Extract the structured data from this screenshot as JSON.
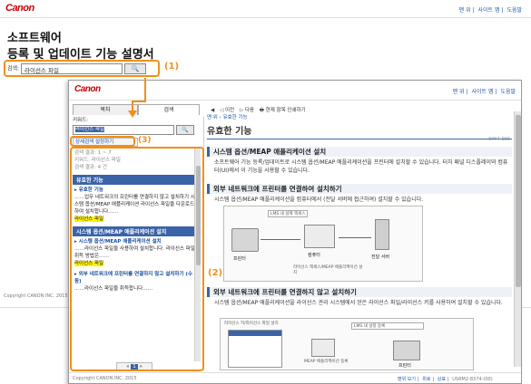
{
  "back": {
    "logo": "Canon",
    "toplinks": [
      "맨 위",
      "사이트 맵",
      "도움말"
    ],
    "title_line1": "소프트웨어",
    "title_line2": "등록 및 업데이트 기능 설명서",
    "search_label": "검색:",
    "search_value": "라이선스 파일",
    "copyright": "Copyright CANON INC. 2015"
  },
  "callouts": {
    "c1": "(1)",
    "c2": "(2)",
    "c3": "(3)"
  },
  "front": {
    "logo": "Canon",
    "toplinks": [
      "맨 위",
      "사이트 맵",
      "도움말"
    ],
    "tabs": [
      "목차",
      "검색"
    ],
    "toolbar": {
      "prev": "이전",
      "next": "다음",
      "print": "현재 항목 인쇄하기"
    },
    "keyword_label": "키워드:",
    "keyword_value": "라이선스 파일",
    "detail_search": "상세검색 설정하기",
    "summary_lines": [
      "검색 결과: 1 ~ 7",
      "키워드: 라이선스 파일",
      "검색 결과: 4 건"
    ],
    "results": [
      {
        "section": "유효한 기능",
        "title": "유효한 기능",
        "snippet": "……업무 네트워크의 프린터를 연결하지 않고 설치하기 시스템 옵션/MEAP 애플리케이션 라이선스 파일을 다운로드하여 설치합니다……"
      },
      {
        "section": "시스템 옵션/MEAP 애플리케이션 설치",
        "title": "시스템 옵션/MEAP 애플리케이션 설치",
        "snippet": "……라이선스 파일을 사용하여 설치합니다. 라이선스 파일 취득 방법은……"
      },
      {
        "section": "",
        "title": "외부 네트워크에 프린터를 연결하지 않고 설치하기 (수동)",
        "snippet": "……라이선스 파일을 취득합니다……"
      }
    ],
    "page_indicator": "1",
    "breadcrumb": "맨 위 › 유효한 기능",
    "page_title": "유효한 기능",
    "page_code": "0YY4-000",
    "sec1_heading": "시스템 옵션/MEAP 애플리케이션 설치",
    "sec1_text": "소프트웨어 기능 등록/업데이트로 시스템 옵션/MEAP 애플리케이션을 프린터에 설치할 수 있습니다. 터치 패널 디스플레이와 컴퓨터(UI)에서 이 기능을 사용할 수 있습니다.",
    "sec2_heading": "외부 네트워크에 프린터를 연결하여 설치하기",
    "sec2_text": "시스템 옵션/MEAP 애플리케이션을 컴퓨터에서 (전달 서버에 접근하여) 설치할 수 있습니다.",
    "diag1": {
      "printer": "프린터",
      "server": "전달 서버",
      "pc": "컴퓨터",
      "arrow_top": "LMS 내 실제 액세스",
      "arrow_bottom": "라이선스 액세스/MEAP 애플리케이션 설치"
    },
    "sec3_heading": "외부 네트워크에 프린터를 연결하지 않고 설치하기",
    "sec3_text": "시스템 옵션/MEAP 애플리케이션을 라이선스 관리 시스템에서 얻은 라이선스 파일/라이선스 키를 사용하여 설치할 수 있습니다.",
    "diag2": {
      "left_label": "라이선스 키/라이선스 파일 설치",
      "right_label": "LMS 내 설정 등록",
      "mid_label": "MEAP 애플리케이션 등록",
      "printer": "프린터",
      "pc": "컴퓨터"
    },
    "footer_links": [
      "맨위 보기",
      "위로",
      "상표"
    ],
    "footer_code": "USRM2-8374-(00)",
    "copyright": "Copyright CANON INC. 2015"
  },
  "colors": {
    "accent": "#f0901a",
    "brand": "#cc0000",
    "header_blue": "#3a63a8",
    "highlight": "#fff200"
  }
}
